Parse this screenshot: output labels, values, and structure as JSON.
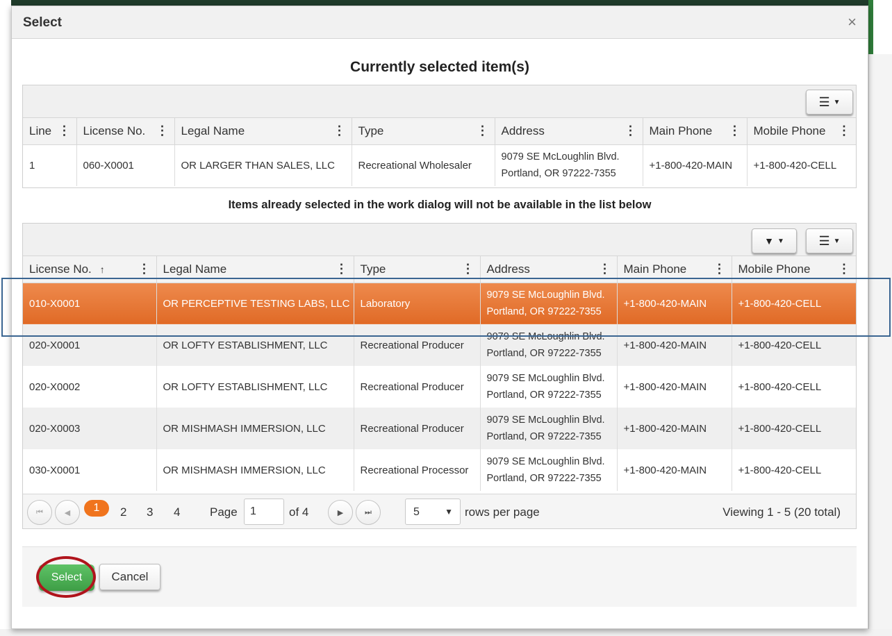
{
  "dialog": {
    "title": "Select",
    "close_label": "×",
    "heading": "Currently selected item(s)",
    "note": "Items already selected in the work dialog will not be available in the list below"
  },
  "selected_grid": {
    "menu_icon": "☰",
    "columns": [
      "Line",
      "License No.",
      "Legal Name",
      "Type",
      "Address",
      "Main Phone",
      "Mobile Phone"
    ],
    "rows": [
      {
        "line": "1",
        "license": "060-X0001",
        "name": "OR LARGER THAN SALES, LLC",
        "type": "Recreational Wholesaler",
        "addr1": "9079 SE McLoughlin Blvd.",
        "addr2": "Portland, OR 97222-7355",
        "main": "+1-800-420-MAIN",
        "mobile": "+1-800-420-CELL"
      }
    ]
  },
  "list_grid": {
    "filter_icon": "▼",
    "menu_icon": "☰",
    "sort_icon": "↑",
    "columns": [
      "License No.",
      "Legal Name",
      "Type",
      "Address",
      "Main Phone",
      "Mobile Phone"
    ],
    "rows": [
      {
        "license": "010-X0001",
        "name": "OR PERCEPTIVE TESTING LABS, LLC",
        "type": "Laboratory",
        "addr1": "9079 SE McLoughlin Blvd.",
        "addr2": "Portland, OR 97222-7355",
        "main": "+1-800-420-MAIN",
        "mobile": "+1-800-420-CELL"
      },
      {
        "license": "020-X0001",
        "name": "OR LOFTY ESTABLISHMENT, LLC",
        "type": "Recreational Producer",
        "addr1": "9079 SE McLoughlin Blvd.",
        "addr2": "Portland, OR 97222-7355",
        "main": "+1-800-420-MAIN",
        "mobile": "+1-800-420-CELL"
      },
      {
        "license": "020-X0002",
        "name": "OR LOFTY ESTABLISHMENT, LLC",
        "type": "Recreational Producer",
        "addr1": "9079 SE McLoughlin Blvd.",
        "addr2": "Portland, OR 97222-7355",
        "main": "+1-800-420-MAIN",
        "mobile": "+1-800-420-CELL"
      },
      {
        "license": "020-X0003",
        "name": "OR MISHMASH IMMERSION, LLC",
        "type": "Recreational Producer",
        "addr1": "9079 SE McLoughlin Blvd.",
        "addr2": "Portland, OR 97222-7355",
        "main": "+1-800-420-MAIN",
        "mobile": "+1-800-420-CELL"
      },
      {
        "license": "030-X0001",
        "name": "OR MISHMASH IMMERSION, LLC",
        "type": "Recreational Processor",
        "addr1": "9079 SE McLoughlin Blvd.",
        "addr2": "Portland, OR 97222-7355",
        "main": "+1-800-420-MAIN",
        "mobile": "+1-800-420-CELL"
      }
    ]
  },
  "pager": {
    "first_icon": "⏮",
    "prev_icon": "◀",
    "next_icon": "▶",
    "last_icon": "⏭",
    "pages": [
      "1",
      "2",
      "3",
      "4"
    ],
    "page_label": "Page",
    "page_value": "1",
    "of_label": "of 4",
    "rows_value": "5",
    "rows_label": "rows per page",
    "viewing": "Viewing 1 - 5 (20 total)"
  },
  "footer": {
    "select_label": "Select",
    "cancel_label": "Cancel"
  },
  "colors": {
    "selected_row": "#e8742e",
    "current_page": "#f0741d",
    "select_button": "#4cae54",
    "annotation_ring": "#b0141c",
    "annotation_box": "#3a6591"
  }
}
